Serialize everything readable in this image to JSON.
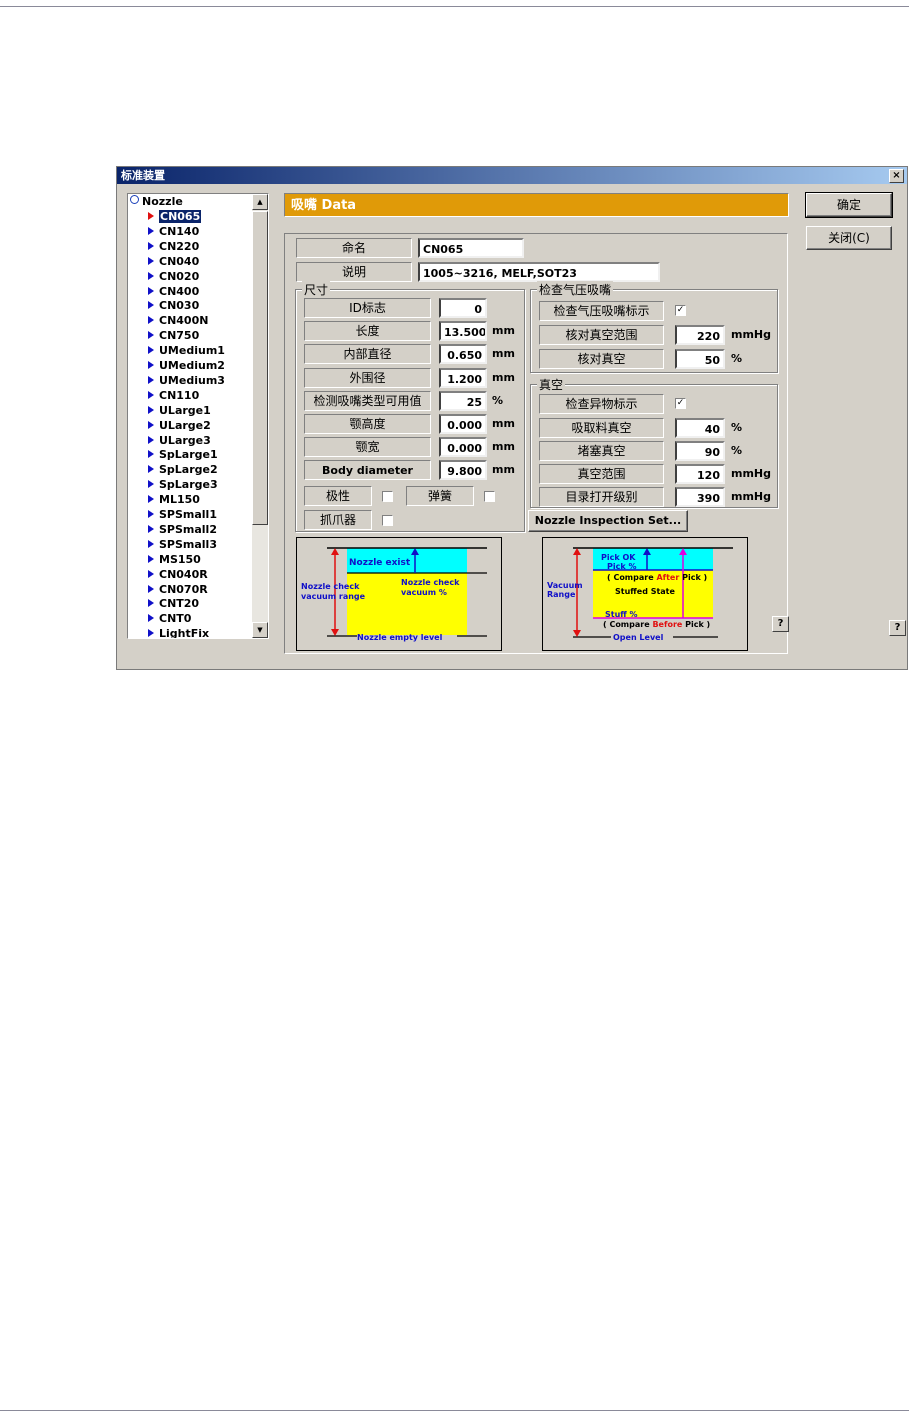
{
  "window": {
    "title": "标准装置",
    "close_label": "×"
  },
  "tree": {
    "root": "Nozzle",
    "selected": "CN065",
    "items": [
      "CN065",
      "CN140",
      "CN220",
      "CN040",
      "CN020",
      "CN400",
      "CN030",
      "CN400N",
      "CN750",
      "UMedium1",
      "UMedium2",
      "UMedium3",
      "CN110",
      "ULarge1",
      "ULarge2",
      "ULarge3",
      "SpLarge1",
      "SpLarge2",
      "SpLarge3",
      "ML150",
      "SPSmall1",
      "SPSmall2",
      "SPSmall3",
      "MS150",
      "CN040R",
      "CN070R",
      "CNT20",
      "CNT0",
      "LightFix"
    ]
  },
  "header": {
    "title": "吸嘴 Data"
  },
  "buttons": {
    "ok": "确定",
    "close": "关闭(C)",
    "inspection": "Nozzle Inspection Set...",
    "help": "?"
  },
  "name_row": {
    "label": "命名",
    "value": "CN065"
  },
  "desc_row": {
    "label": "说明",
    "value": "1005~3216, MELF,SOT23"
  },
  "size_group": {
    "title": "尺寸",
    "rows": [
      {
        "label": "ID标志",
        "value": "0",
        "unit": ""
      },
      {
        "label": "长度",
        "value": "13.500",
        "unit": "mm"
      },
      {
        "label": "内部直径",
        "value": "0.650",
        "unit": "mm"
      },
      {
        "label": "外围径",
        "value": "1.200",
        "unit": "mm"
      },
      {
        "label": "检测吸嘴类型可用值",
        "value": "25",
        "unit": "%"
      },
      {
        "label": "颚高度",
        "value": "0.000",
        "unit": "mm"
      },
      {
        "label": "颚宽",
        "value": "0.000",
        "unit": "mm"
      },
      {
        "label": "Body diameter",
        "value": "9.800",
        "unit": "mm"
      }
    ],
    "polarity": "极性",
    "spring": "弹簧",
    "gripper": "抓爪器"
  },
  "pressure_group": {
    "title": "检查气压吸嘴",
    "check_label": "检查气压吸嘴标示",
    "check_mark": "✓",
    "rows": [
      {
        "label": "核对真空范围",
        "value": "220",
        "unit": "mmHg"
      },
      {
        "label": "核对真空",
        "value": "50",
        "unit": "%"
      }
    ]
  },
  "vacuum_group": {
    "title": "真空",
    "check_label": "检查异物标示",
    "check_mark": "✓",
    "rows": [
      {
        "label": "吸取料真空",
        "value": "40",
        "unit": "%"
      },
      {
        "label": "堵塞真空",
        "value": "90",
        "unit": "%"
      },
      {
        "label": "真空范围",
        "value": "120",
        "unit": "mmHg"
      },
      {
        "label": "目录打开级别",
        "value": "390",
        "unit": "mmHg"
      }
    ]
  },
  "diagram_left": {
    "nozzle_exist": "Nozzle exist",
    "check_range_1": "Nozzle check",
    "check_range_2": "vacuum range",
    "check_pct_1": "Nozzle check",
    "check_pct_2": "vacuum %",
    "empty_level": "Nozzle empty level",
    "colors": {
      "top": "#00ffff",
      "bottom": "#ffff00",
      "range_arrow": "#e01010",
      "pct_arrow": "#1010c8"
    }
  },
  "diagram_right": {
    "pick_ok": "Pick OK",
    "pick_pct": "Pick %",
    "compare_after_pre": "( Compare ",
    "compare_after_word": "After",
    "compare_after_post": " Pick )",
    "stuffed_state": "Stuffed State",
    "vacuum_1": "Vacuum",
    "vacuum_2": "Range",
    "stuff_pct": "Stuff %",
    "compare_before_pre": "( Compare ",
    "compare_before_word": "Before",
    "compare_before_post": " Pick )",
    "open_level": "Open Level",
    "colors": {
      "top": "#00ffff",
      "bottom": "#ffff00",
      "accent": "#e01010",
      "magenta": "#e000e0",
      "blue": "#1010c8"
    }
  }
}
